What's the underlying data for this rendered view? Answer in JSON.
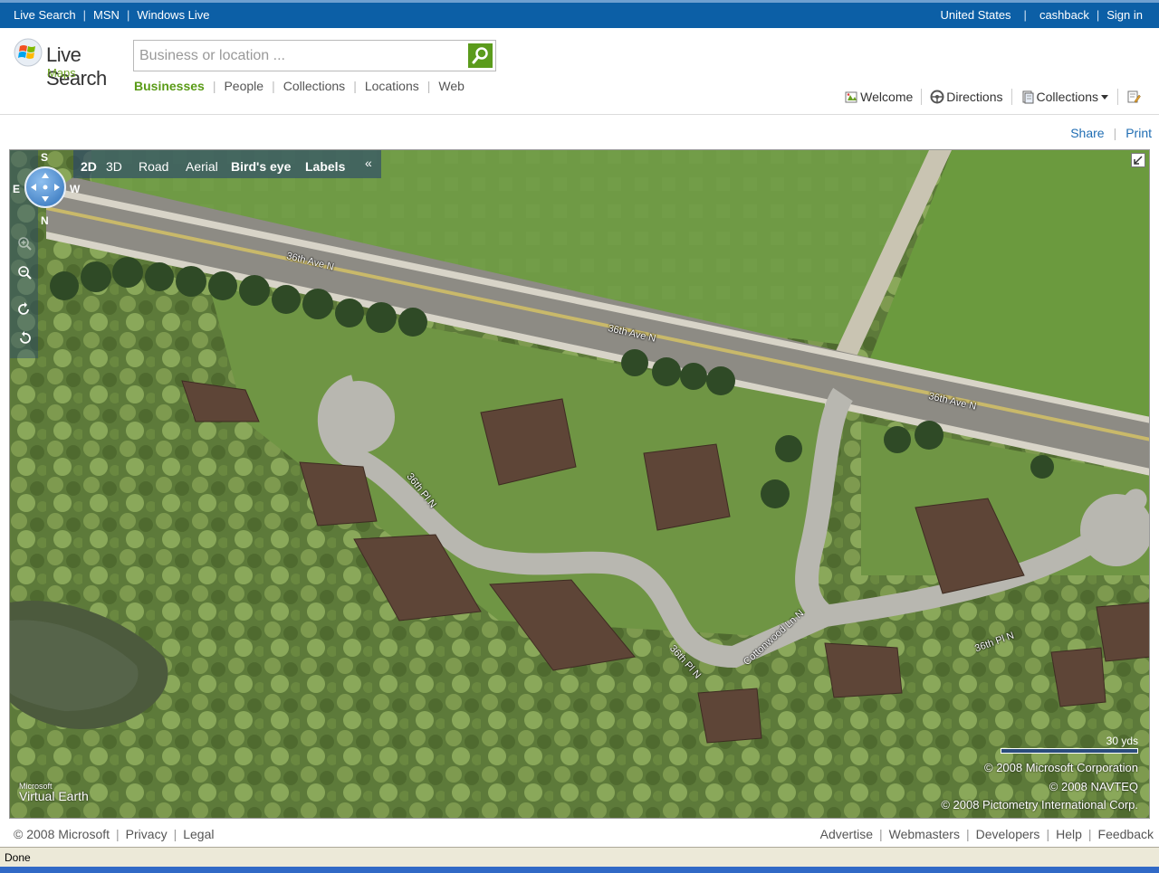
{
  "topbar": {
    "links": [
      "Live Search",
      "MSN",
      "Windows Live"
    ],
    "region": "United States",
    "cashback": "cashback",
    "signin": "Sign in"
  },
  "logo": {
    "title": "Live Search",
    "subtitle": "Maps"
  },
  "search": {
    "placeholder": "Business or location ..."
  },
  "scopes": [
    "Businesses",
    "People",
    "Collections",
    "Locations",
    "Web"
  ],
  "active_scope": "Businesses",
  "toolbar": {
    "welcome": "Welcome",
    "directions": "Directions",
    "collections": "Collections"
  },
  "share": "Share",
  "print": "Print",
  "map": {
    "view_2d": "2D",
    "view_3d": "3D",
    "road": "Road",
    "aerial": "Aerial",
    "birds_eye": "Bird's eye",
    "labels": "Labels",
    "collapse": "«",
    "compass": {
      "top": "S",
      "left": "E",
      "right": "W",
      "bottom": "N"
    },
    "road_labels": [
      "36th Ave N",
      "36th Ave N",
      "36th Ave N",
      "36th Pl N",
      "36th Pl N",
      "Cottonwood Ln N",
      "36th Pl N"
    ],
    "scale": "30 yds",
    "copyright": [
      "© 2008 Microsoft Corporation",
      "© 2008 NAVTEQ",
      "© 2008 Pictometry International Corp."
    ],
    "ve_logo_small": "Microsoft",
    "ve_logo_big": "Virtual Earth"
  },
  "footer": {
    "left": [
      "© 2008 Microsoft",
      "Privacy",
      "Legal"
    ],
    "right": [
      "Advertise",
      "Webmasters",
      "Developers",
      "Help",
      "Feedback"
    ]
  },
  "status": "Done"
}
